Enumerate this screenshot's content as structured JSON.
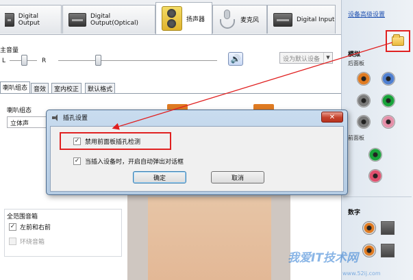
{
  "tabs": [
    {
      "label": "Digital Output"
    },
    {
      "label": "Digital Output(Optical)"
    },
    {
      "label": "扬声器"
    },
    {
      "label": "麦克风"
    },
    {
      "label": "Digital Input"
    }
  ],
  "volume": {
    "title": "主音量",
    "left_label": "L",
    "right_label": "R",
    "default_device_label": "设为默认设备",
    "dropdown_arrow": "▼"
  },
  "subtabs": [
    {
      "label": "喇叭组态"
    },
    {
      "label": "音效"
    },
    {
      "label": "室内校正"
    },
    {
      "label": "默认格式"
    }
  ],
  "speaker_config": {
    "label": "喇叭组态",
    "value": "立体声"
  },
  "full_range": {
    "title": "全范围音箱",
    "front_lr": {
      "label": "左前和右前",
      "checked": true
    },
    "surround": {
      "label": "环绕音箱",
      "checked": false,
      "disabled": true
    }
  },
  "right_panel": {
    "advanced_link": "设备高级设置",
    "analog_title": "模拟",
    "rear_panel": "后面板",
    "front_panel": "前面板",
    "digital_title": "数字",
    "rear_jacks": [
      "#e07b22",
      "#4f7fd0",
      "#7a7a7a",
      "#19a33a",
      "#7a7a7a",
      "#e58fa8"
    ],
    "front_jacks": [
      "#19a33a",
      "#e0506e"
    ]
  },
  "dialog": {
    "title": "插孔设置",
    "close_glyph": "✕",
    "option1": {
      "label": "禁用前面板插孔检测",
      "checked": true
    },
    "option2": {
      "label": "当插入设备时，开启自动弹出对话框",
      "checked": true
    },
    "ok_label": "确定",
    "cancel_label": "取消"
  },
  "watermark": {
    "text": "我爱IT技术网",
    "url": "www.52ij.com"
  },
  "colors": {
    "highlight_red": "#e02020",
    "link_blue": "#1d4fb0",
    "dialog_frame": "#b4cbe3"
  }
}
